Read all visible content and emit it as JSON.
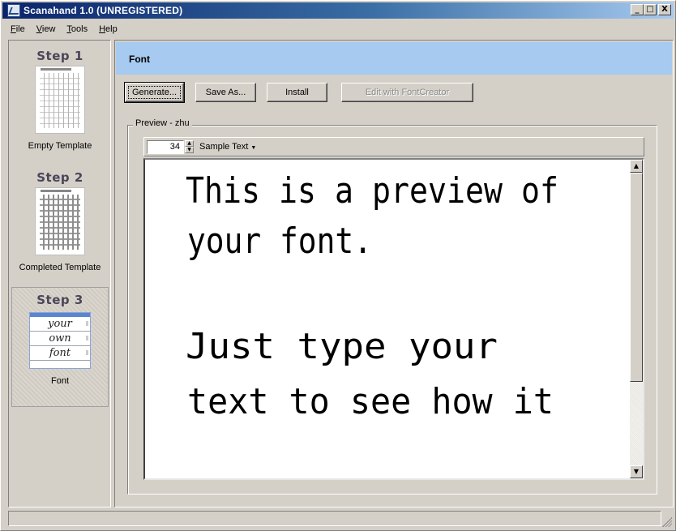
{
  "window": {
    "title": "Scanahand 1.0 (UNREGISTERED)",
    "controls": {
      "minimize": "_",
      "maximize": "□",
      "close": "X"
    }
  },
  "menu": [
    {
      "label": "File",
      "access_key": "F",
      "rest": "ile"
    },
    {
      "label": "View",
      "access_key": "V",
      "rest": "iew"
    },
    {
      "label": "Tools",
      "access_key": "T",
      "rest": "ools"
    },
    {
      "label": "Help",
      "access_key": "H",
      "rest": "elp"
    }
  ],
  "steps": [
    {
      "title": "Step 1",
      "label": "Empty Template",
      "selected": false
    },
    {
      "title": "Step 2",
      "label": "Completed Template",
      "selected": false
    },
    {
      "title": "Step 3",
      "label": "Font",
      "selected": true,
      "thumb_lines": [
        "your",
        "own",
        "font"
      ]
    }
  ],
  "panel": {
    "header": "Font",
    "buttons": {
      "generate": "Generate...",
      "save_as": "Save As...",
      "install": "Install",
      "edit": "Edit with FontCreator"
    },
    "preview_group": "Preview - zhu",
    "font_size": "34",
    "sample_select": "Sample Text",
    "preview_lines": [
      "This is a preview of",
      "your font.",
      "",
      "Just type your",
      "text to see how it"
    ]
  },
  "colors": {
    "title_start": "#0a246a",
    "title_end": "#a6caf0",
    "header_bg": "#a6caf0",
    "face": "#d4d0c8"
  },
  "icons": {
    "app": "scanahand-app-icon",
    "spin_up": "spin-up-icon",
    "spin_down": "spin-down-icon",
    "dropdown": "caret-down-icon",
    "scroll_up": "scroll-up-icon",
    "scroll_down": "scroll-down-icon",
    "size_grip": "size-grip-icon"
  }
}
